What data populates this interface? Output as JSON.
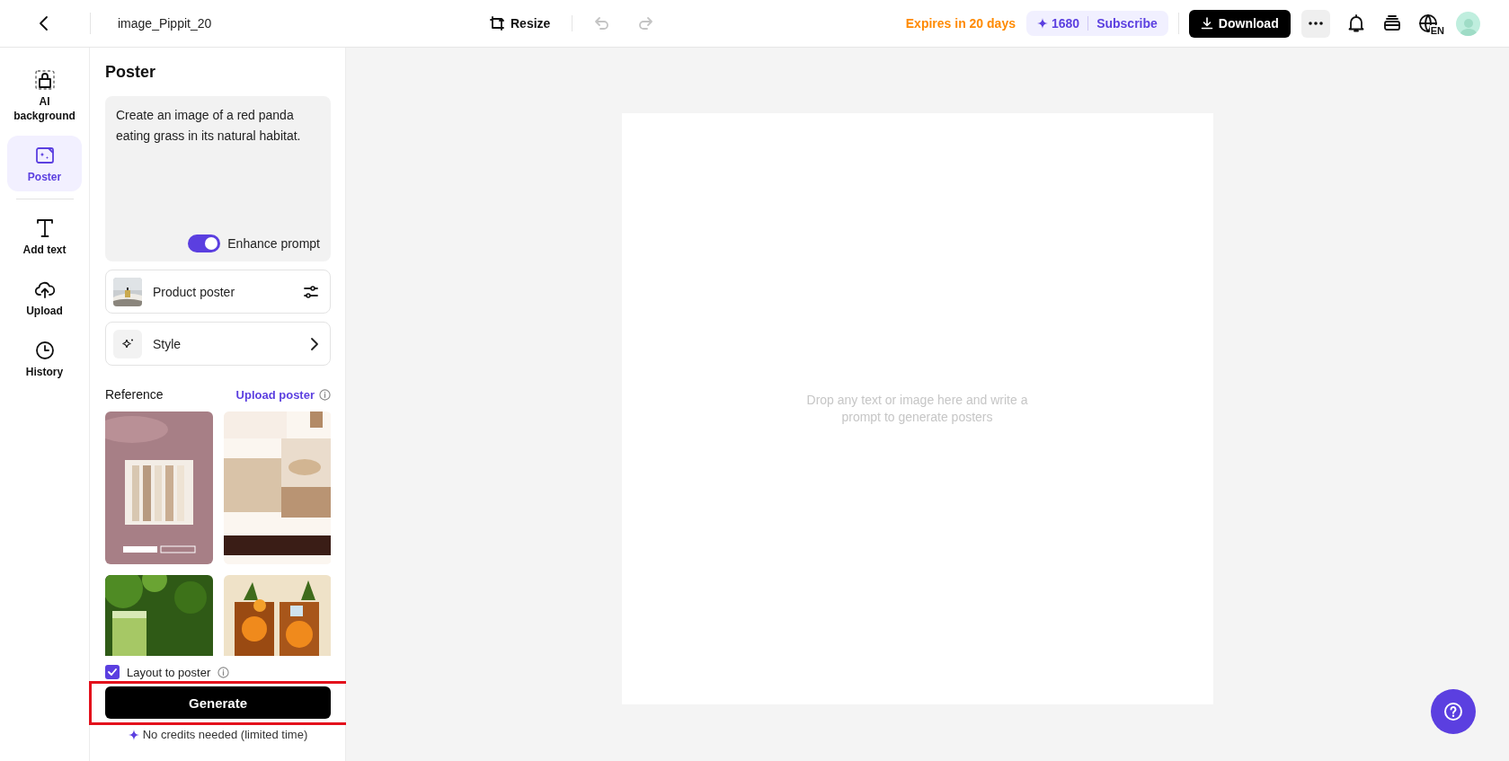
{
  "topbar": {
    "title": "image_Pippit_20",
    "resize": "Resize",
    "history_buttons": [
      {
        "kind": "undo",
        "disabled": true
      },
      {
        "kind": "redo",
        "disabled": true
      }
    ],
    "expires": "Expires in 20 days",
    "credits": "1680",
    "subscribe": "Subscribe",
    "download": "Download",
    "language": "EN"
  },
  "rail": {
    "items": [
      {
        "kind": "ai_background",
        "label": "AI background",
        "selected": false
      },
      {
        "kind": "poster",
        "label": "Poster",
        "selected": true
      },
      {
        "kind": "text",
        "label": "Add text",
        "selected": false
      },
      {
        "kind": "upload",
        "label": "Upload",
        "selected": false
      },
      {
        "kind": "history",
        "label": "History",
        "selected": false
      }
    ]
  },
  "panel": {
    "title": "Poster",
    "prompt": {
      "value": "Create an image of a red panda eating grass in its natural habitat.",
      "enhance_label": "Enhance prompt",
      "enhance_on": true
    },
    "options": [
      {
        "kind": "product",
        "label": "Product poster"
      },
      {
        "kind": "style",
        "label": "Style"
      }
    ],
    "reference": {
      "title": "Reference",
      "upload": "Upload poster"
    },
    "layout": {
      "label": "Layout to poster",
      "checked": true
    },
    "generate": "Generate",
    "note": "No credits needed (limited time)"
  },
  "canvas": {
    "hint": "Drop any text or image here and write a prompt to generate posters"
  }
}
